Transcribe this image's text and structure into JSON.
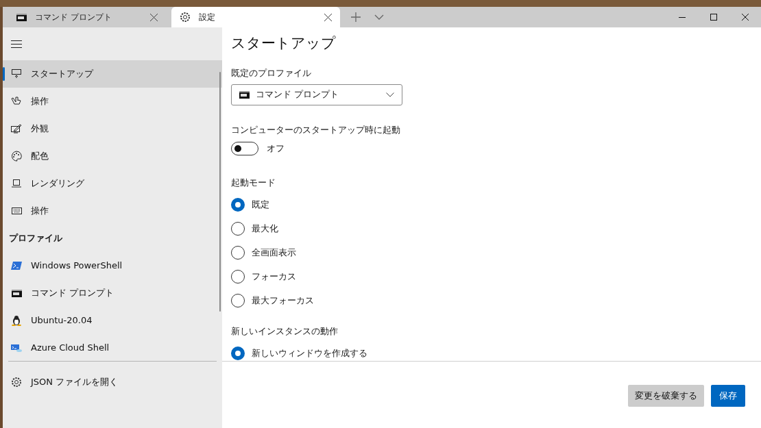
{
  "tabs": [
    {
      "label": "コマンド プロンプト",
      "selected": false
    },
    {
      "label": "設定",
      "selected": true
    }
  ],
  "sidebar": {
    "items": [
      {
        "label": "スタートアップ",
        "selected": true
      },
      {
        "label": "操作",
        "selected": false
      },
      {
        "label": "外観",
        "selected": false
      },
      {
        "label": "配色",
        "selected": false
      },
      {
        "label": "レンダリング",
        "selected": false
      },
      {
        "label": "操作",
        "selected": false
      }
    ],
    "profiles_heading": "プロファイル",
    "profiles": [
      {
        "label": "Windows PowerShell",
        "selected": false
      },
      {
        "label": "コマンド プロンプト",
        "selected": false
      },
      {
        "label": "Ubuntu-20.04",
        "selected": false
      },
      {
        "label": "Azure Cloud Shell",
        "selected": false
      }
    ],
    "footer_item": "JSON ファイルを開く"
  },
  "page": {
    "title": "スタートアップ",
    "default_profile": {
      "label": "既定のプロファイル",
      "value": "コマンド プロンプト"
    },
    "launch_on_startup": {
      "label": "コンピューターのスタートアップ時に起動",
      "on": false,
      "state_text": "オフ"
    },
    "launch_mode": {
      "label": "起動モード",
      "options": [
        {
          "label": "既定",
          "selected": true
        },
        {
          "label": "最大化",
          "selected": false
        },
        {
          "label": "全画面表示",
          "selected": false
        },
        {
          "label": "フォーカス",
          "selected": false
        },
        {
          "label": "最大フォーカス",
          "selected": false
        }
      ]
    },
    "new_instance": {
      "label": "新しいインスタンスの動作",
      "options": [
        {
          "label": "新しいウィンドウを作成する",
          "selected": true
        }
      ]
    }
  },
  "buttons": [
    {
      "label": "変更を破棄する",
      "kind": "secondary"
    },
    {
      "label": "保存",
      "kind": "primary"
    }
  ]
}
